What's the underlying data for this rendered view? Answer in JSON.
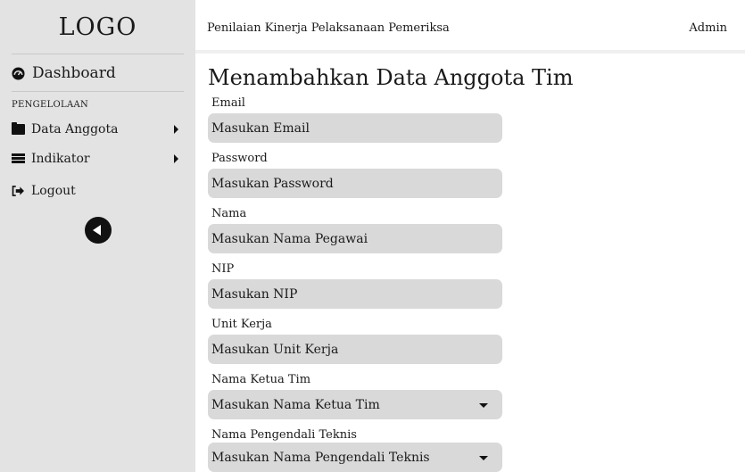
{
  "sidebar": {
    "logo": "LOGO",
    "dashboard": {
      "label": "Dashboard",
      "icon": "tachometer-icon"
    },
    "section_label": "PENGELOLAAN",
    "items": [
      {
        "label": "Data Anggota",
        "icon": "folder-icon",
        "has_submenu": true
      },
      {
        "label": "Indikator",
        "icon": "server-icon",
        "has_submenu": true
      },
      {
        "label": "Logout",
        "icon": "sign-out-icon",
        "has_submenu": false
      }
    ],
    "collapse_icon": "chevron-left-circle-icon"
  },
  "header": {
    "title": "Penilaian Kinerja Pelaksanaan Pemeriksa",
    "user": "Admin"
  },
  "main": {
    "title": "Menambahkan Data Anggota Tim",
    "fields": [
      {
        "label": "Email",
        "placeholder": "Masukan Email",
        "type": "input"
      },
      {
        "label": "Password",
        "placeholder": "Masukan Password",
        "type": "input"
      },
      {
        "label": "Nama",
        "placeholder": "Masukan Nama Pegawai",
        "type": "input"
      },
      {
        "label": "NIP",
        "placeholder": "Masukan NIP",
        "type": "input"
      },
      {
        "label": "Unit Kerja",
        "placeholder": "Masukan Unit Kerja",
        "type": "input"
      },
      {
        "label": "Nama Ketua Tim",
        "placeholder": "Masukan Nama Ketua Tim",
        "type": "select"
      },
      {
        "label": "Nama Pengendali Teknis",
        "placeholder": "Masukan Nama Pengendali Teknis",
        "type": "select"
      }
    ]
  },
  "colors": {
    "sidebar_bg": "#e3e3e3",
    "field_bg": "#d9d9d9",
    "text": "#1a1a1a"
  }
}
